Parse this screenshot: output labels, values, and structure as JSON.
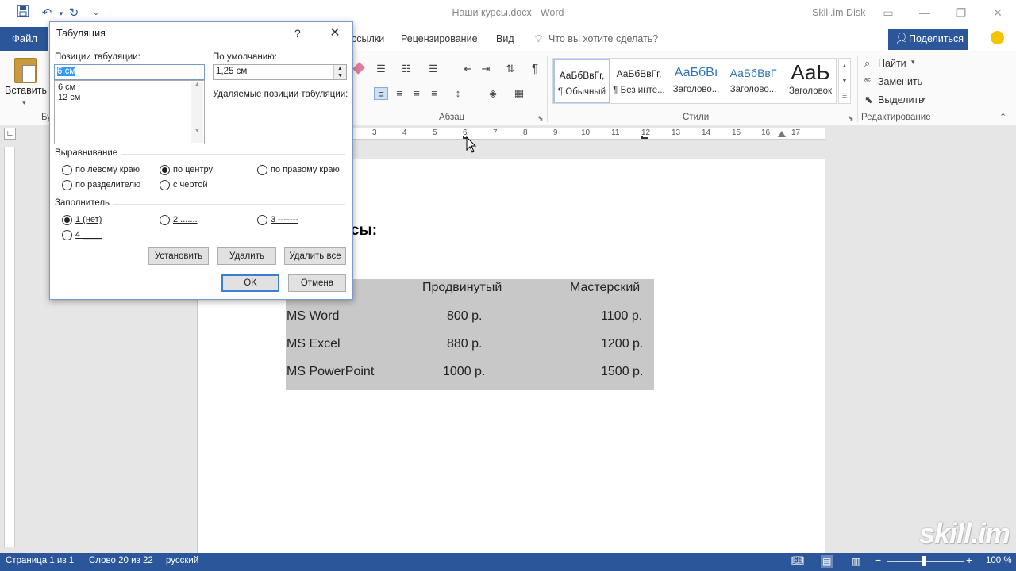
{
  "titlebar": {
    "doc_title": "Наши курсы.docx  -  Word",
    "disk_label": "Skill.im Disk"
  },
  "tabs": {
    "file": "Файл",
    "items": [
      "ссылки",
      "Рецензирование",
      "Вид"
    ],
    "tellme": "Что вы хотите сделать?",
    "share": "Поделиться"
  },
  "ribbon": {
    "paste_label": "Вставить",
    "clipboard_group_partial": "Бу",
    "paragraph_group": "Абзац",
    "styles_group": "Стили",
    "editing_group": "Редактирование",
    "styles": [
      {
        "sample": "АаБбВвГг,",
        "name": "¶ Обычный"
      },
      {
        "sample": "АаБбВвГг,",
        "name": "¶ Без инте..."
      },
      {
        "sample": "АаБбВı",
        "name": "Заголово..."
      },
      {
        "sample": "АаБбВвГ",
        "name": "Заголово..."
      },
      {
        "sample": "АаЬ",
        "name": "Заголовок"
      }
    ],
    "find": "Найти",
    "replace": "Заменить",
    "select": "Выделить"
  },
  "ruler": {
    "marks": [
      "3",
      "4",
      "5",
      "6",
      "7",
      "8",
      "9",
      "10",
      "11",
      "12",
      "13",
      "14",
      "15",
      "16",
      "17"
    ]
  },
  "document": {
    "heading_partial": "урсы:",
    "table": {
      "header": [
        "",
        "Продвинутый",
        "Мастерский"
      ],
      "rows": [
        [
          "MS Word",
          "800 р.",
          "1100 р."
        ],
        [
          "MS Excel",
          "880 р.",
          "1200 р."
        ],
        [
          "MS PowerPoint",
          "1000 р.",
          "1500 р."
        ]
      ]
    }
  },
  "dialog": {
    "title": "Табуляция",
    "help": "?",
    "tab_positions_label": "Позиции табуляции:",
    "tab_position_value": "6 см",
    "tab_positions_list": [
      "6 см",
      "12 см"
    ],
    "default_label": "По умолчанию:",
    "default_value": "1,25 см",
    "removed_label": "Удаляемые позиции табуляции:",
    "alignment_label": "Выравнивание",
    "alignment_options": [
      "по левому краю",
      "по центру",
      "по правому краю",
      "по разделителю",
      "с чертой"
    ],
    "alignment_selected": "по центру",
    "leader_label": "Заполнитель",
    "leader_options": [
      "1 (нет)",
      "2 .......",
      "3 -------",
      "4 ____"
    ],
    "leader_selected": "1 (нет)",
    "btn_set": "Установить",
    "btn_clear": "Удалить",
    "btn_clear_all": "Удалить все",
    "btn_ok": "OK",
    "btn_cancel": "Отмена"
  },
  "statusbar": {
    "page": "Страница 1 из 1",
    "words": "Слово 20 из 22",
    "language": "русский",
    "zoom": "100 %"
  },
  "watermark": "skill.im",
  "colors": {
    "accent": "#2b579a",
    "table_shading": "#c8c8c8"
  }
}
